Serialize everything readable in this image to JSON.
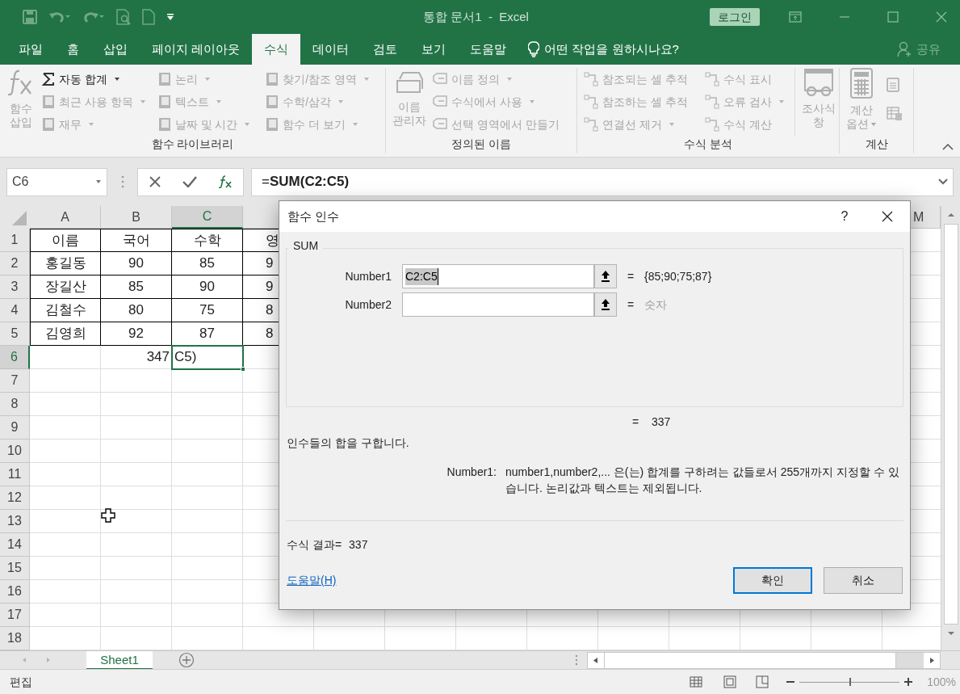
{
  "title_bar": {
    "title": "통합 문서1  -  Excel",
    "login_button": "로그인"
  },
  "tabs": [
    {
      "label": "파일",
      "selected": false
    },
    {
      "label": "홈",
      "selected": false
    },
    {
      "label": "삽입",
      "selected": false
    },
    {
      "label": "페이지 레이아웃",
      "selected": false
    },
    {
      "label": "수식",
      "selected": true
    },
    {
      "label": "데이터",
      "selected": false
    },
    {
      "label": "검토",
      "selected": false
    },
    {
      "label": "보기",
      "selected": false
    },
    {
      "label": "도움말",
      "selected": false
    }
  ],
  "tell_me": "어떤 작업을 원하시나요?",
  "share": "공유",
  "ribbon": {
    "groups": [
      {
        "label": "함수 라이브러리",
        "parts": [
          {
            "kind": "big",
            "lines": [
              "함수",
              "삽입"
            ],
            "disabled": true,
            "dropdown": false
          },
          {
            "kind": "column",
            "items": [
              {
                "label": "자동 합계",
                "disabled": false,
                "dropdown": true
              },
              {
                "label": "최근 사용 항목",
                "disabled": true,
                "dropdown": true
              },
              {
                "label": "재무",
                "disabled": true,
                "dropdown": true
              }
            ]
          },
          {
            "kind": "column",
            "items": [
              {
                "label": "논리",
                "disabled": true,
                "dropdown": true
              },
              {
                "label": "텍스트",
                "disabled": true,
                "dropdown": true
              },
              {
                "label": "날짜 및 시간",
                "disabled": true,
                "dropdown": true
              }
            ]
          },
          {
            "kind": "column",
            "items": [
              {
                "label": "찾기/참조 영역",
                "disabled": true,
                "dropdown": true
              },
              {
                "label": "수학/삼각",
                "disabled": true,
                "dropdown": true
              },
              {
                "label": "함수 더 보기",
                "disabled": true,
                "dropdown": true
              }
            ]
          }
        ]
      },
      {
        "label": "정의된 이름",
        "parts": [
          {
            "kind": "big",
            "lines": [
              "이름",
              "관리자"
            ],
            "disabled": true,
            "dropdown": false
          },
          {
            "kind": "column",
            "items": [
              {
                "label": "이름 정의",
                "disabled": true,
                "dropdown": true
              },
              {
                "label": "수식에서 사용",
                "disabled": true,
                "dropdown": true
              },
              {
                "label": "선택 영역에서 만들기",
                "disabled": true,
                "dropdown": false
              }
            ]
          }
        ]
      },
      {
        "label": "수식 분석",
        "parts": [
          {
            "kind": "column",
            "items": [
              {
                "label": "참조되는 셀 추적",
                "disabled": true,
                "dropdown": false
              },
              {
                "label": "참조하는 셀 추적",
                "disabled": true,
                "dropdown": false
              },
              {
                "label": "연결선 제거",
                "disabled": true,
                "dropdown": true
              }
            ]
          },
          {
            "kind": "column",
            "items": [
              {
                "label": "수식 표시",
                "disabled": true,
                "dropdown": false
              },
              {
                "label": "오류 검사",
                "disabled": true,
                "dropdown": true
              },
              {
                "label": "수식 계산",
                "disabled": true,
                "dropdown": false
              }
            ]
          },
          {
            "kind": "big",
            "lines": [
              "조사식",
              "창"
            ],
            "disabled": true,
            "dropdown": false
          }
        ]
      },
      {
        "label": "계산",
        "parts": [
          {
            "kind": "big",
            "lines": [
              "계산",
              "옵션"
            ],
            "disabled": true,
            "dropdown": true
          },
          {
            "kind": "icon_column"
          }
        ]
      }
    ]
  },
  "formula_bar": {
    "name_box": "C6",
    "formula": "=**SUM(C2:C5)**"
  },
  "sheet": {
    "columns": [
      {
        "letter": "A",
        "selected": false
      },
      {
        "letter": "B",
        "selected": false
      },
      {
        "letter": "C",
        "selected": true
      },
      {
        "selected": false
      },
      {
        "letter": "M",
        "selected": false
      }
    ],
    "rows": [
      {
        "number": "1",
        "selected": false,
        "bordered": true,
        "cells": [
          {
            "text": "이름"
          },
          {
            "text": "국어"
          },
          {
            "text": "수학"
          },
          {
            "text": "영"
          }
        ]
      },
      {
        "number": "2",
        "selected": false,
        "bordered": true,
        "cells": [
          {
            "text": "홍길동"
          },
          {
            "text": "90"
          },
          {
            "text": "85"
          },
          {
            "text": "9"
          }
        ]
      },
      {
        "number": "3",
        "selected": false,
        "bordered": true,
        "cells": [
          {
            "text": "장길산"
          },
          {
            "text": "85"
          },
          {
            "text": "90"
          },
          {
            "text": "9"
          }
        ]
      },
      {
        "number": "4",
        "selected": false,
        "bordered": true,
        "cells": [
          {
            "text": "김철수"
          },
          {
            "text": "80"
          },
          {
            "text": "75"
          },
          {
            "text": "8"
          }
        ]
      },
      {
        "number": "5",
        "selected": false,
        "bordered": true,
        "cells": [
          {
            "text": "김영희"
          },
          {
            "text": "92"
          },
          {
            "text": "87"
          },
          {
            "text": "8"
          }
        ]
      },
      {
        "number": "6",
        "selected": true,
        "bordered": false,
        "cells": [
          null,
          {
            "text": "347",
            "active": false
          },
          {
            "text": "C5)",
            "active": true
          }
        ]
      },
      {
        "number": "7",
        "selected": false,
        "bordered": false
      },
      {
        "number": "8",
        "selected": false,
        "bordered": false
      },
      {
        "number": "9",
        "selected": false,
        "bordered": false
      },
      {
        "number": "10",
        "selected": false,
        "bordered": false
      },
      {
        "number": "11",
        "selected": false,
        "bordered": false
      },
      {
        "number": "12",
        "selected": false,
        "bordered": false
      },
      {
        "number": "13",
        "selected": false,
        "bordered": false
      },
      {
        "number": "14",
        "selected": false,
        "bordered": false
      },
      {
        "number": "15",
        "selected": false,
        "bordered": false
      },
      {
        "number": "16",
        "selected": false,
        "bordered": false
      },
      {
        "number": "17",
        "selected": false,
        "bordered": false
      },
      {
        "number": "18",
        "selected": false,
        "bordered": false
      }
    ]
  },
  "dialog": {
    "title": "함수 인수",
    "help": "?",
    "function_name": "SUM",
    "args": [
      {
        "label": "Number1",
        "value": "C2:C5",
        "text_selected": true,
        "equals": "=",
        "result": "{85;90;75;87}",
        "hint": false
      },
      {
        "label": "Number2",
        "equals": "=",
        "result": "숫자",
        "hint": true
      }
    ],
    "total_equals": "=",
    "total": "337",
    "description": "인수들의 합을 구합니다.",
    "arg_help_label": "Number1:",
    "arg_help": "number1,number2,... 은(는) 합계를 구하려는 값들로서 255개까지 지정할 수 있습니다. 논리값과 텍스트는 제외됩니다.",
    "result_label": "수식 결과=",
    "result": "337",
    "help_link": "도움말(H)",
    "buttons": [
      {
        "label": "확인",
        "default": true
      },
      {
        "label": "취소",
        "default": false
      }
    ]
  },
  "sheet_tabs": [
    {
      "label": "Sheet1",
      "selected": true
    }
  ],
  "status_bar": {
    "mode": "편집",
    "zoom": {
      "level": 0.5,
      "reading": "100%"
    }
  }
}
